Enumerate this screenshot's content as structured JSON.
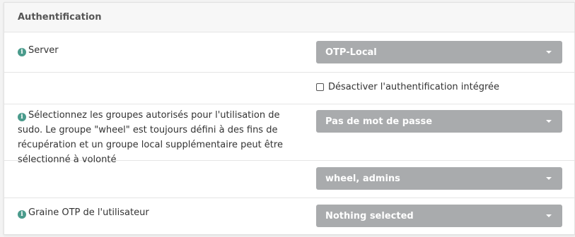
{
  "panel": {
    "title": "Authentification"
  },
  "rows": {
    "server": {
      "label": "Server",
      "select_value": "OTP-Local"
    },
    "disable_auth": {
      "checkbox_label": "Désactiver l'authentification intégrée",
      "checked": false
    },
    "sudo_groups": {
      "label": "Sélectionnez les groupes autorisés pour l'utilisation de sudo. Le groupe \"wheel\" est toujours défini à des fins de récupération et un groupe local supplémentaire peut être sélectionné à volonté",
      "select_value": "Pas de mot de passe"
    },
    "groups": {
      "select_value": "wheel, admins"
    },
    "otp_seed": {
      "label": "Graine OTP de l'utilisateur",
      "select_value": "Nothing selected"
    }
  },
  "colors": {
    "info_icon": "#4a9b8c",
    "select_bg": "#a9abad"
  },
  "icons": {
    "info": "info-icon",
    "caret": "caret-down-icon"
  }
}
